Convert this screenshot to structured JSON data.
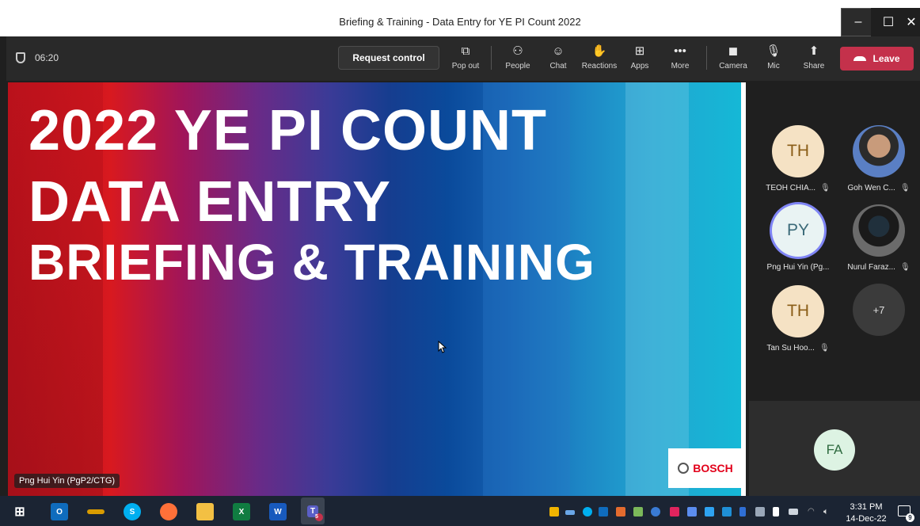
{
  "window": {
    "title": "Briefing & Training - Data Entry for YE PI Count 2022",
    "minimize": "–",
    "maximize": "☐",
    "close": "✕"
  },
  "toolbar": {
    "timer": "06:20",
    "request_control": "Request control",
    "tools": [
      {
        "label": "Pop out",
        "icon": "pop-out-icon"
      },
      {
        "label": "People",
        "icon": "people-icon"
      },
      {
        "label": "Chat",
        "icon": "chat-icon"
      },
      {
        "label": "Reactions",
        "icon": "reactions-icon"
      },
      {
        "label": "Apps",
        "icon": "apps-icon"
      },
      {
        "label": "More",
        "icon": "more-icon"
      },
      {
        "label": "Camera",
        "icon": "camera-off-icon"
      },
      {
        "label": "Mic",
        "icon": "mic-off-icon"
      },
      {
        "label": "Share",
        "icon": "share-icon"
      }
    ],
    "leave": "Leave",
    "leave_color": "#c4314b"
  },
  "slide": {
    "line1": "2022 YE PI COUNT",
    "line2": "DATA ENTRY",
    "line3": "BRIEFING & TRAINING",
    "brand": "BOSCH",
    "presenter": "Png Hui Yin (PgP2/CTG)"
  },
  "participants": {
    "teoh": {
      "initials": "TH",
      "name": "TEOH CHIA..."
    },
    "goh": {
      "name": "Goh Wen C..."
    },
    "png": {
      "initials": "PY",
      "name": "Png Hui Yin (Pg..."
    },
    "nurul": {
      "name": "Nurul Faraz..."
    },
    "tan": {
      "initials": "TH",
      "name": "Tan Su Hoo..."
    },
    "more": "+7",
    "fa": "FA"
  },
  "taskbar": {
    "time": "3:31 PM",
    "date": "14-Dec-22",
    "teams_badge": "5",
    "notif_count": "9"
  }
}
